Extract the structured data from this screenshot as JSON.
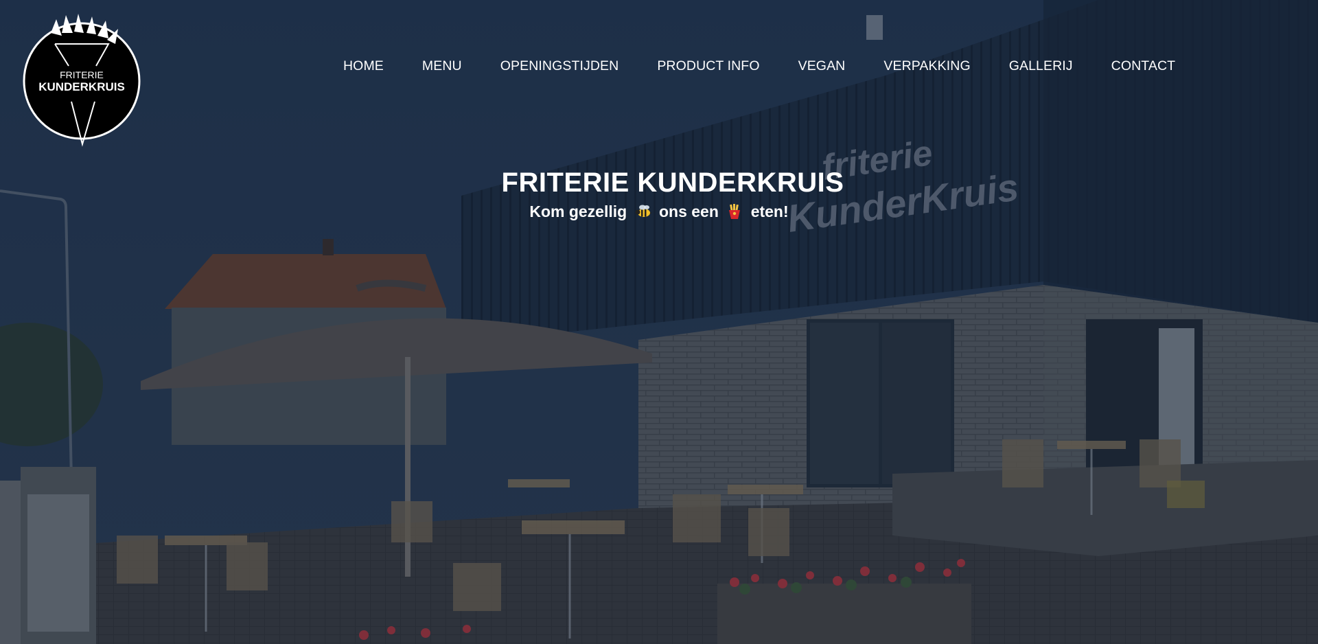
{
  "site": {
    "logo_top_text": "FRITERIE",
    "logo_bottom_text": "KUNDERKRUIS"
  },
  "nav": {
    "items": [
      {
        "label": "HOME"
      },
      {
        "label": "MENU"
      },
      {
        "label": "OPENINGSTIJDEN"
      },
      {
        "label": "PRODUCT INFO"
      },
      {
        "label": "VEGAN"
      },
      {
        "label": "VERPAKKING"
      },
      {
        "label": "GALLERIJ"
      },
      {
        "label": "CONTACT"
      }
    ]
  },
  "hero": {
    "title": "FRITERIE KUNDERKRUIS",
    "tagline_part1": "Kom gezellig",
    "tagline_part2": "ons een",
    "tagline_part3": "eten!",
    "emoji_1": "bee-icon",
    "emoji_2": "fries-icon",
    "building_sign_line1": "friterie",
    "building_sign_line2": "KunderKruis"
  },
  "colors": {
    "overlay": "#14243c",
    "text": "#ffffff",
    "sky": "#2a3a52",
    "building": "#1d2b3f"
  }
}
